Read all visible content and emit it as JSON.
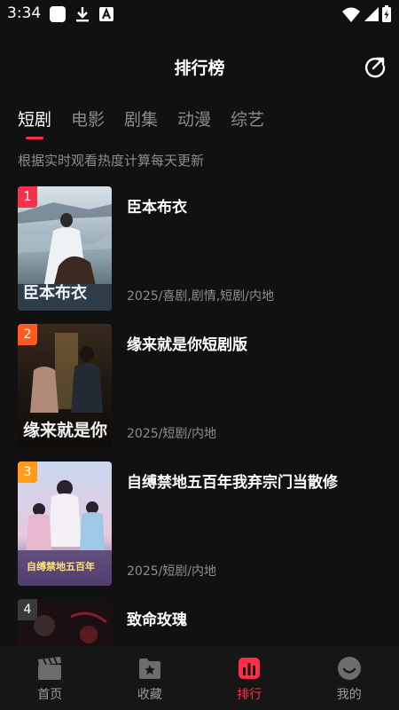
{
  "status_bar": {
    "time": "3:34"
  },
  "header": {
    "title": "排行榜"
  },
  "tabs": [
    {
      "label": "短剧",
      "active": true
    },
    {
      "label": "电影",
      "active": false
    },
    {
      "label": "剧集",
      "active": false
    },
    {
      "label": "动漫",
      "active": false
    },
    {
      "label": "综艺",
      "active": false
    }
  ],
  "subtitle": "根据实时观看热度计算每天更新",
  "items": [
    {
      "rank": "1",
      "title": "臣本布衣",
      "meta": "2025/喜剧,剧情,短剧/内地",
      "poster_caption": "臣本布衣",
      "rank_color": "#f0324b"
    },
    {
      "rank": "2",
      "title": "缘来就是你短剧版",
      "meta": "2025/短剧/内地",
      "poster_caption": "缘来就是你",
      "rank_color": "#ff5a1f"
    },
    {
      "rank": "3",
      "title": "自缚禁地五百年我弃宗门当散修",
      "meta": "2025/短剧/内地",
      "poster_caption": "自缚禁地五百年",
      "rank_color": "#ff9a1a"
    },
    {
      "rank": "4",
      "title": "致命玫瑰",
      "meta": "",
      "poster_caption": "",
      "rank_color": "#3a3a3a"
    }
  ],
  "bottom_nav": [
    {
      "label": "首页",
      "icon": "clapperboard-icon",
      "active": false
    },
    {
      "label": "收藏",
      "icon": "star-folder-icon",
      "active": false
    },
    {
      "label": "排行",
      "icon": "chart-icon",
      "active": true
    },
    {
      "label": "我的",
      "icon": "smile-icon",
      "active": false
    }
  ],
  "colors": {
    "accent": "#ff2d45",
    "background": "#111111"
  }
}
